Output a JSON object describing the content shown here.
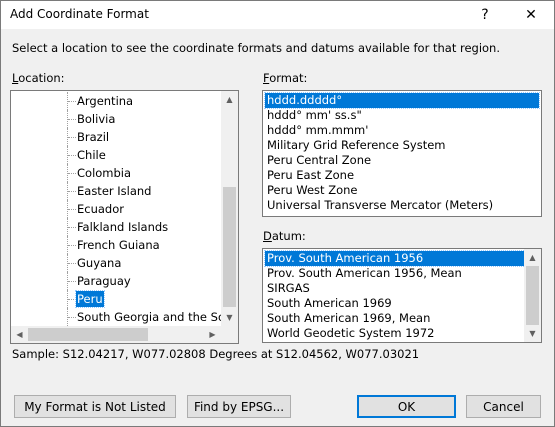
{
  "window": {
    "title": "Add Coordinate Format",
    "help_glyph": "?",
    "close_glyph": "✕"
  },
  "instruction": "Select a location to see the coordinate formats and datums available for that region.",
  "location": {
    "label_accel": "L",
    "label_rest": "ocation:",
    "items": [
      "Argentina",
      "Bolivia",
      "Brazil",
      "Chile",
      "Colombia",
      "Easter Island",
      "Ecuador",
      "Falkland Islands",
      "French Guiana",
      "Guyana",
      "Paraguay",
      "Peru",
      "South Georgia and the Sout"
    ],
    "selected_index": 11
  },
  "format": {
    "label_accel": "F",
    "label_rest": "ormat:",
    "items": [
      "hddd.ddddd°",
      "hddd° mm' ss.s\"",
      "hddd° mm.mmm'",
      "Military Grid Reference System",
      "Peru Central Zone",
      "Peru East Zone",
      "Peru West Zone",
      "Universal Transverse Mercator (Meters)"
    ],
    "selected_index": 0
  },
  "datum": {
    "label_accel": "D",
    "label_rest": "atum:",
    "items": [
      "Prov. South American 1956",
      "Prov. South American 1956, Mean",
      "SIRGAS",
      "South American 1969",
      "South American 1969, Mean",
      "World Geodetic System 1972"
    ],
    "selected_index": 0
  },
  "sample": "Sample: S12.04217, W077.02808 Degrees at S12.04562, W077.03021",
  "buttons": {
    "not_listed": "My Format is Not Listed",
    "find_epsg": "Find by EPSG...",
    "ok": "OK",
    "cancel": "Cancel"
  },
  "scroll_glyphs": {
    "up": "▲",
    "down": "▼",
    "left": "◀",
    "right": "▶"
  },
  "colors": {
    "selection": "#0078d7",
    "dialog_bg": "#f0f0f0"
  }
}
